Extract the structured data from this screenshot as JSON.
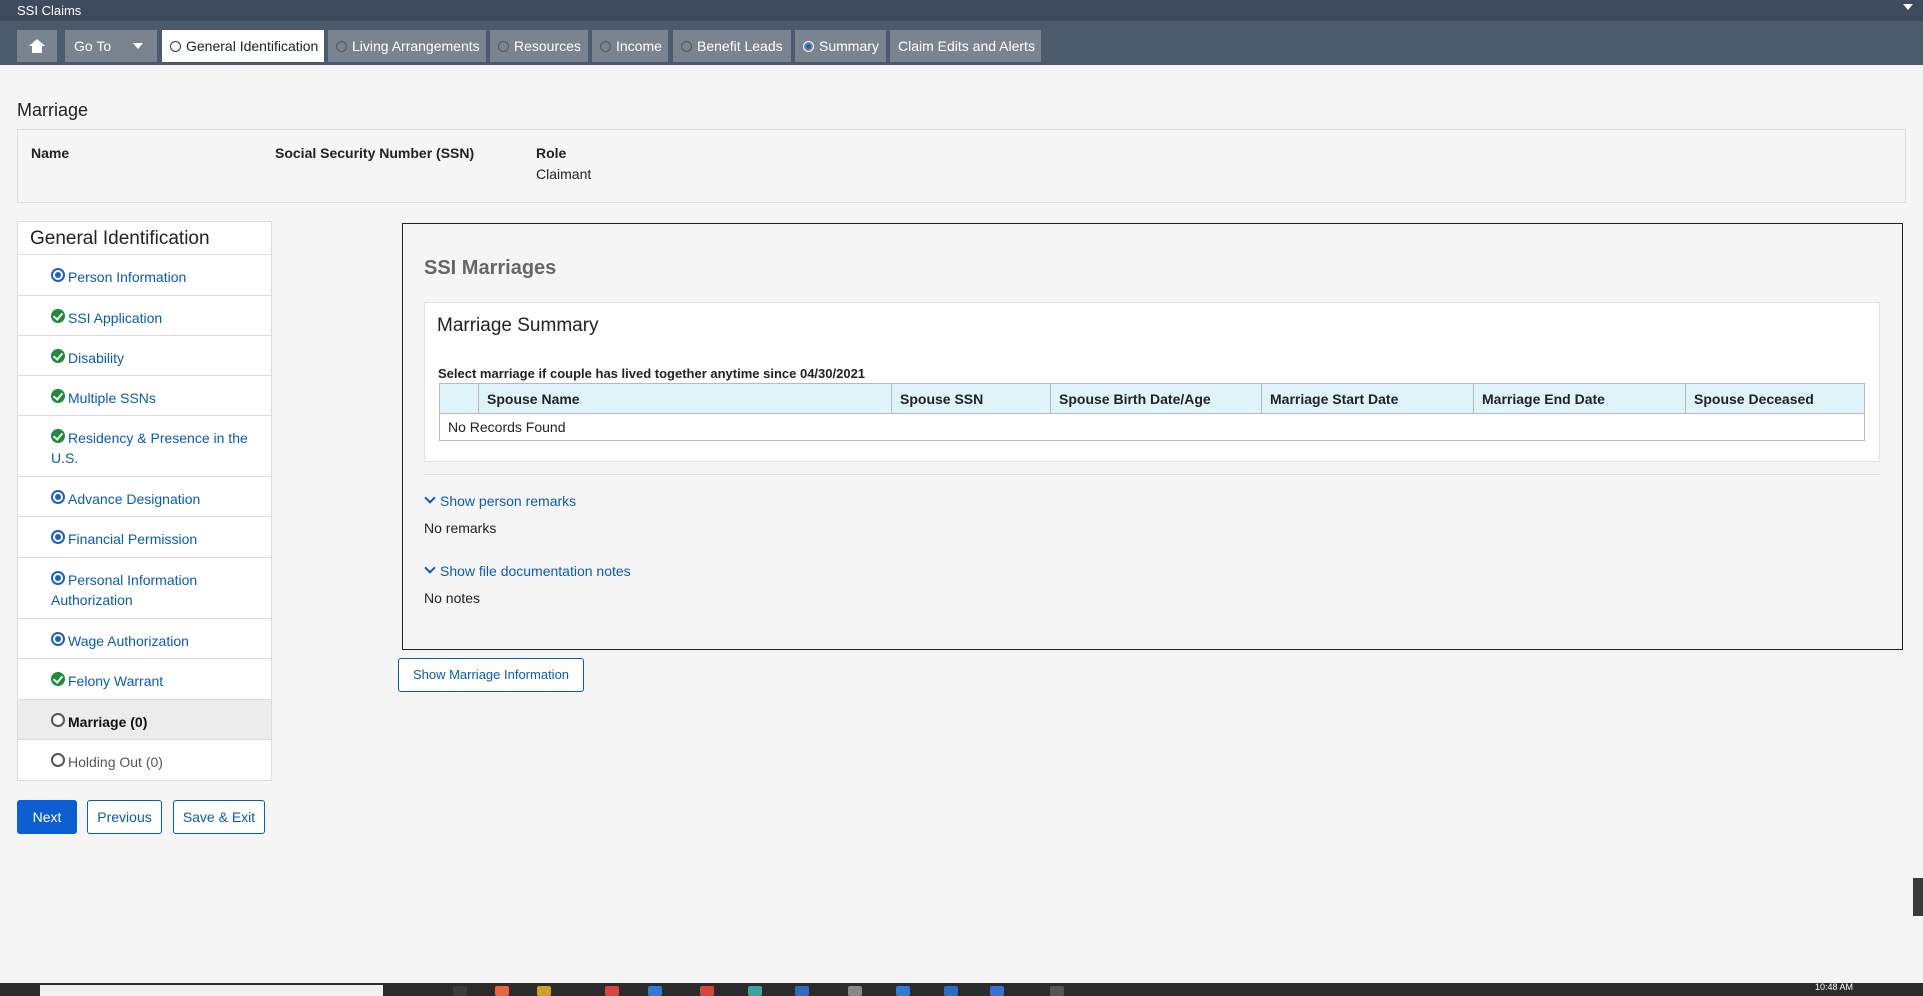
{
  "app": {
    "title": "SSI Claims"
  },
  "nav": {
    "goto_label": "Go To",
    "tabs": [
      {
        "label": "General Identification",
        "state": "active"
      },
      {
        "label": "Living Arrangements",
        "state": "open"
      },
      {
        "label": "Resources",
        "state": "open"
      },
      {
        "label": "Income",
        "state": "open"
      },
      {
        "label": "Benefit Leads",
        "state": "open"
      },
      {
        "label": "Summary",
        "state": "selected"
      },
      {
        "label": "Claim Edits and Alerts",
        "state": "plain"
      }
    ]
  },
  "page": {
    "title": "Marriage"
  },
  "person": {
    "name_label": "Name",
    "name_value": "",
    "ssn_label": "Social Security Number (SSN)",
    "ssn_value": "",
    "role_label": "Role",
    "role_value": "Claimant"
  },
  "sidebar": {
    "title": "General Identification",
    "items": [
      {
        "label": "Person Information",
        "status": "in-progress"
      },
      {
        "label": "SSI Application",
        "status": "complete"
      },
      {
        "label": "Disability",
        "status": "complete"
      },
      {
        "label": "Multiple SSNs",
        "status": "complete"
      },
      {
        "label": "Residency & Presence in the U.S.",
        "status": "complete"
      },
      {
        "label": "Advance Designation",
        "status": "in-progress"
      },
      {
        "label": "Financial Permission",
        "status": "in-progress"
      },
      {
        "label": "Personal Information Authorization",
        "status": "in-progress"
      },
      {
        "label": "Wage Authorization",
        "status": "in-progress"
      },
      {
        "label": "Felony Warrant",
        "status": "complete"
      },
      {
        "label": "Marriage (0)",
        "status": "current"
      },
      {
        "label": "Holding Out (0)",
        "status": "not-started"
      }
    ]
  },
  "buttons": {
    "next": "Next",
    "previous": "Previous",
    "save_exit": "Save & Exit",
    "show_marriage_info": "Show Marriage Information"
  },
  "panel": {
    "title": "SSI Marriages",
    "summary_title": "Marriage Summary",
    "instruction": "Select marriage if couple has lived together anytime since 04/30/2021",
    "columns": [
      "",
      "Spouse Name",
      "Spouse SSN",
      "Spouse Birth Date/Age",
      "Marriage Start Date",
      "Marriage End Date",
      "Spouse Deceased"
    ],
    "empty_text": "No Records Found",
    "remarks_toggle": "Show person remarks",
    "remarks_text": "No remarks",
    "notes_toggle": "Show file documentation notes",
    "notes_text": "No notes"
  },
  "taskbar": {
    "clock": "10:48 AM"
  },
  "colors": {
    "nav_bg": "#4b5b6d",
    "accent_blue": "#0b5fd0",
    "complete_green": "#1e8c3a",
    "grid_header": "#dff3fb"
  }
}
